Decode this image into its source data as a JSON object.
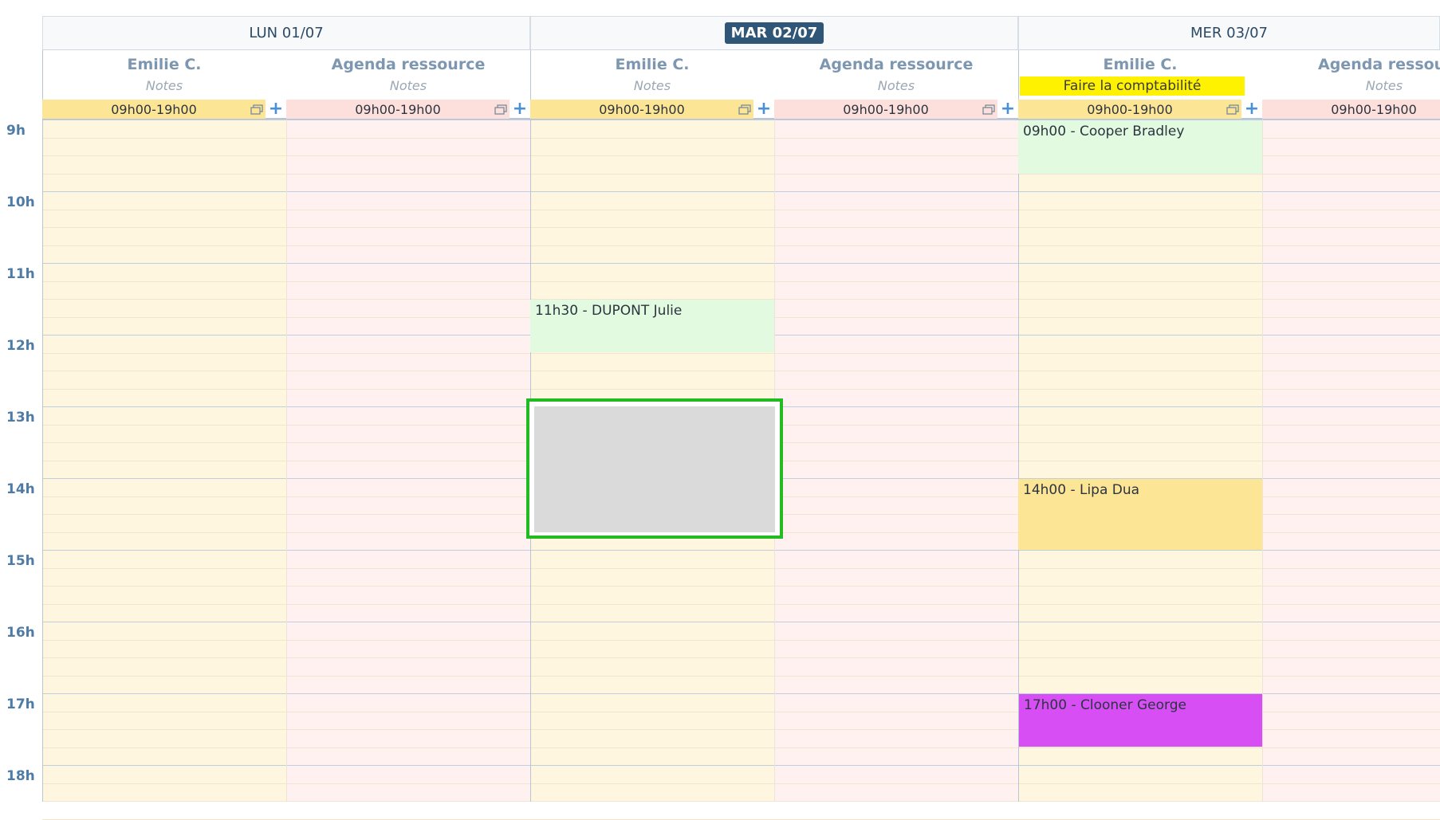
{
  "hours": [
    "9h",
    "10h",
    "11h",
    "12h",
    "13h",
    "14h",
    "15h",
    "16h",
    "17h",
    "18h"
  ],
  "days": [
    {
      "label": "LUN 01/07",
      "current": false
    },
    {
      "label": "MAR 02/07",
      "current": true
    },
    {
      "label": "MER 03/07",
      "current": false
    }
  ],
  "resources": {
    "emilie": {
      "name": "Emilie C.",
      "notes_placeholder": "Notes"
    },
    "agenda": {
      "name": "Agenda ressource",
      "name_truncated": "Agenda ressourc",
      "notes_placeholder": "Notes"
    }
  },
  "day_notes": {
    "mer_emilie": "Faire la comptabilité"
  },
  "hours_range": "09h00-19h00",
  "events": [
    {
      "label": "11h30 - DUPONT Julie",
      "color": "#e2fbe0"
    },
    {
      "label": "09h00 - Cooper Bradley",
      "color": "#e2fbe0"
    },
    {
      "label": "14h00 - Lipa Dua",
      "color": "#fde596"
    },
    {
      "label": "17h00 - Clooner George",
      "color": "#d74ff4"
    }
  ],
  "colors": {
    "header_bg": "#f7f9fb",
    "current_day_badge": "#2f5577",
    "emilie_hours_bar": "#fde596",
    "agenda_hours_bar": "#fde0dc",
    "emilie_column": "#fef6df",
    "agenda_column": "#fff1f0",
    "selection_border": "#22bb22",
    "note_highlight": "#fff200"
  },
  "icons": {
    "copy": "copy-icon",
    "plus": "plus-icon"
  }
}
